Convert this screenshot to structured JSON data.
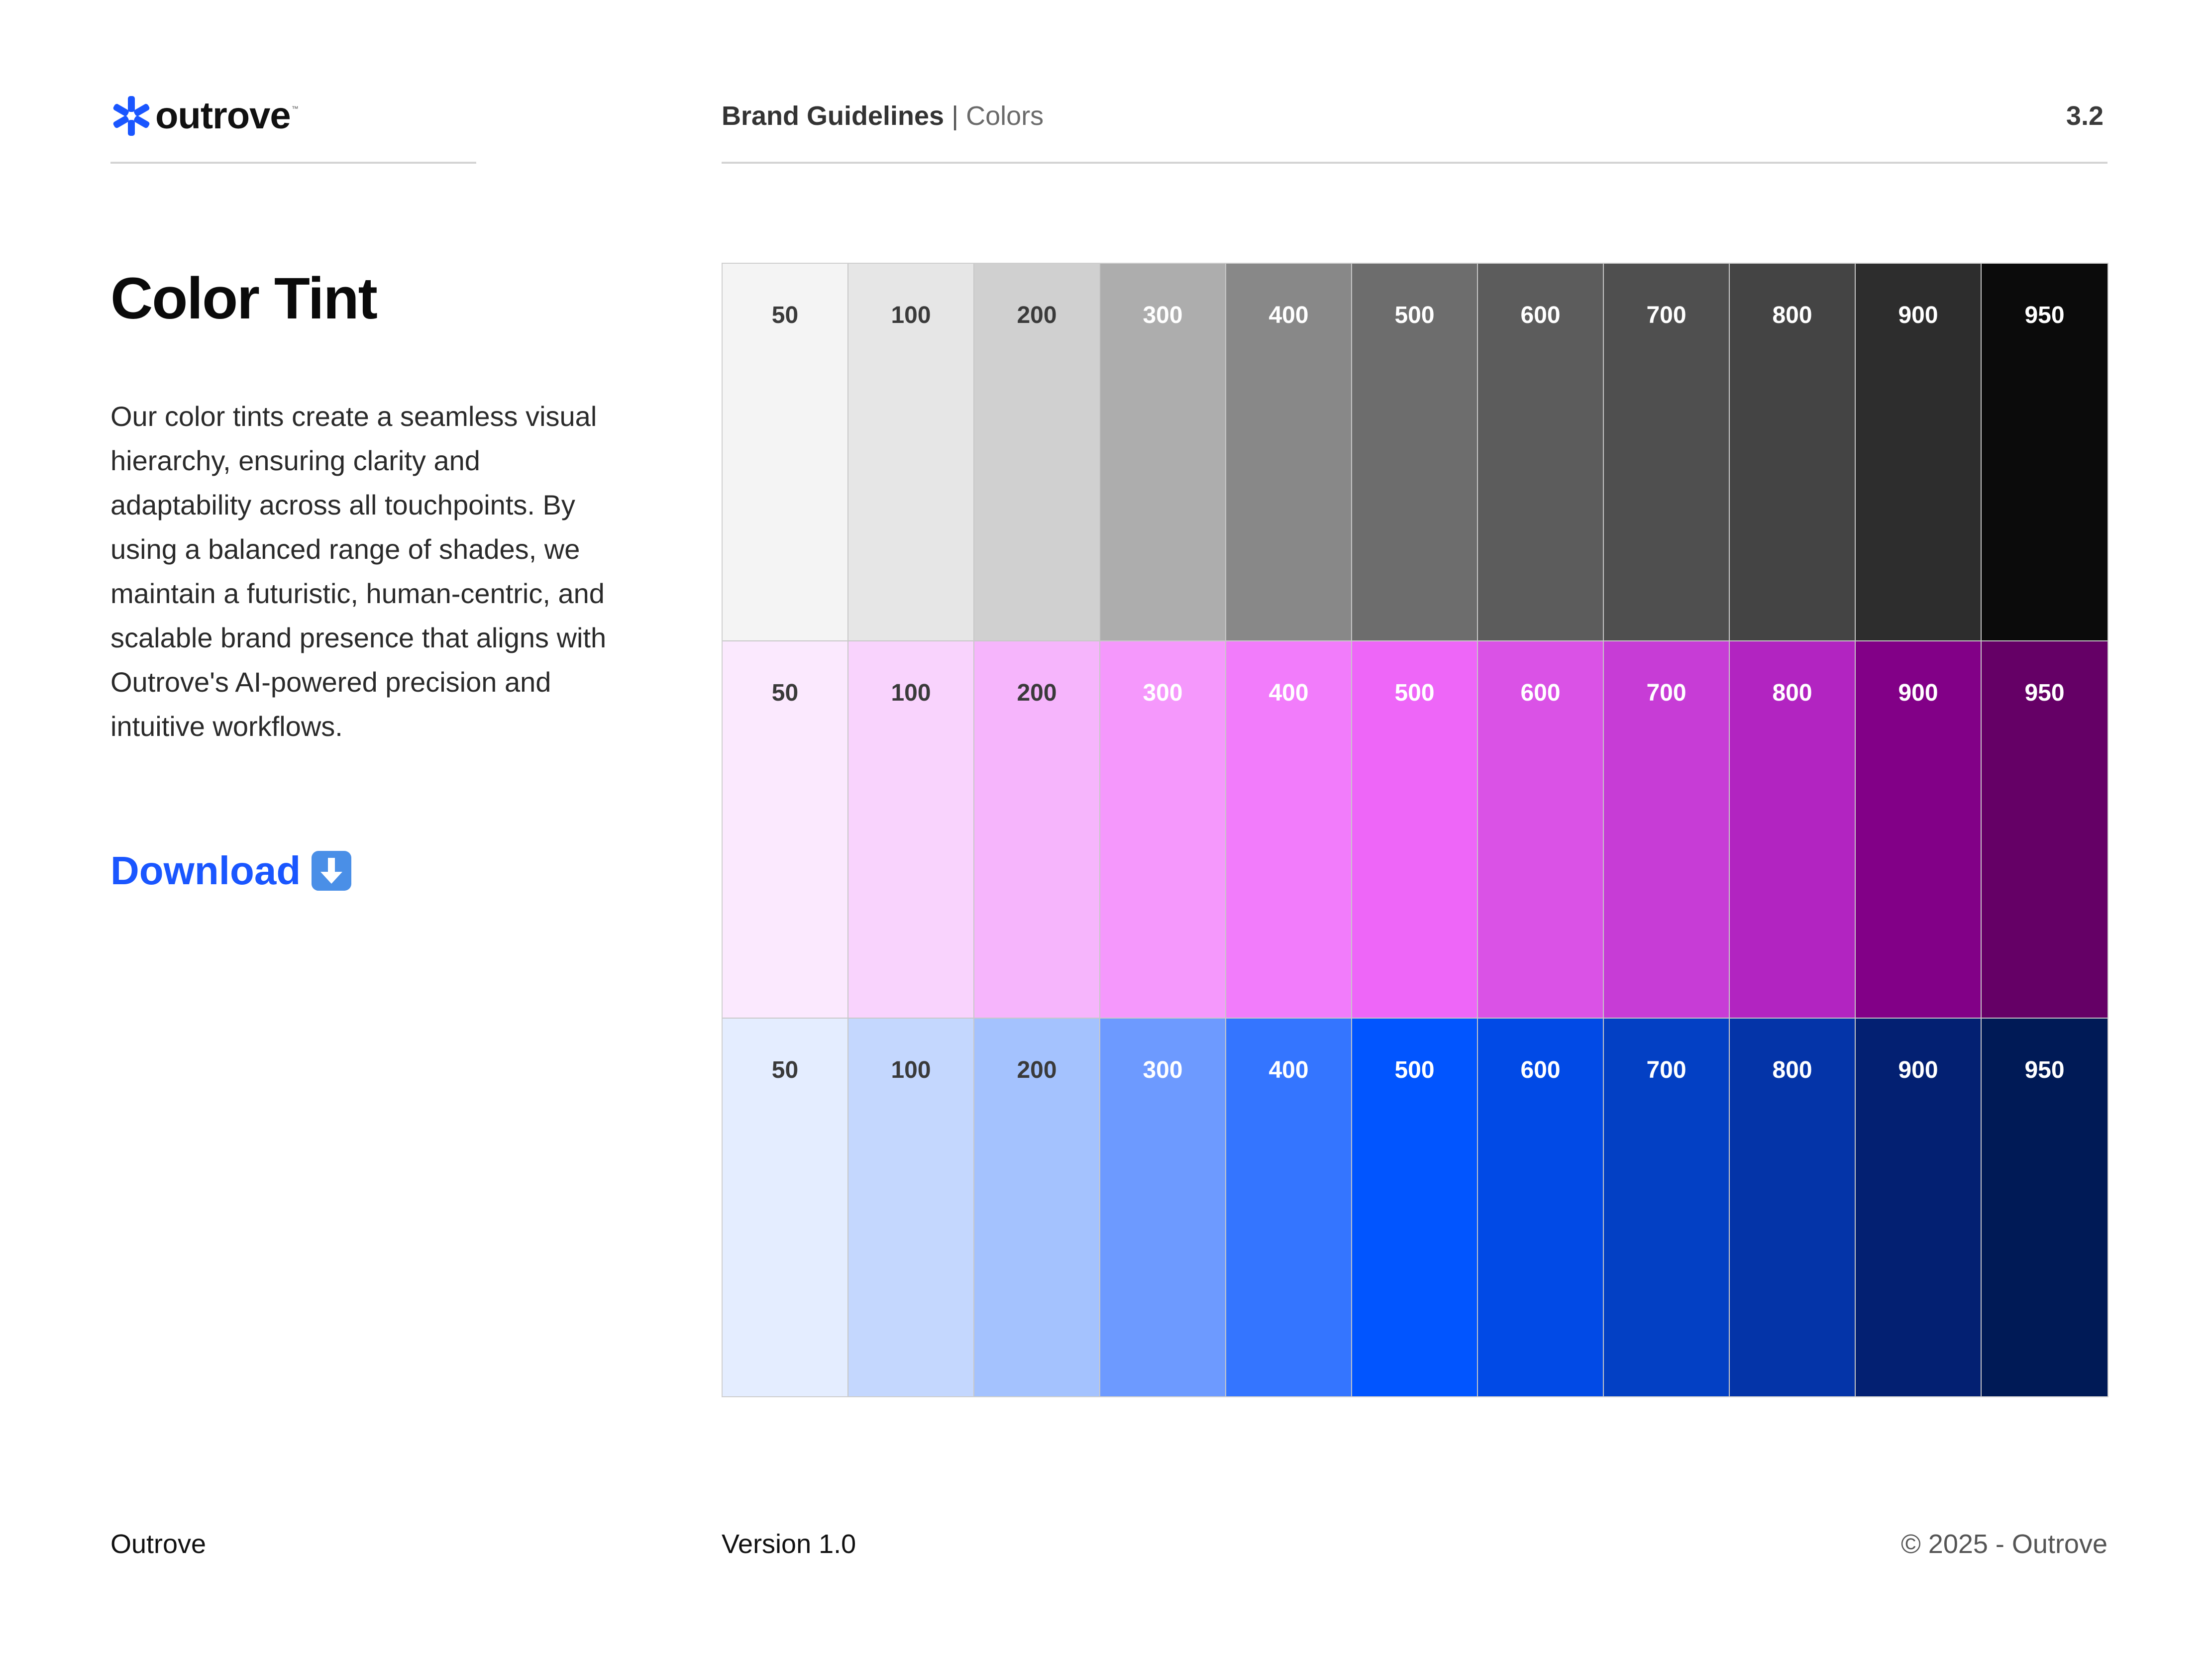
{
  "brand": {
    "logo_text": "outrove",
    "logo_tm": "™",
    "logo_color": "#1a56ff"
  },
  "header": {
    "title": "Brand Guidelines",
    "separator": " | ",
    "section": "Colors",
    "page_number": "3.2"
  },
  "main": {
    "title": "Color Tint",
    "description": "Our color tints create a seamless visual hierarchy, ensuring clarity and adaptability across all touchpoints. By using a balanced range of shades, we maintain a futuristic, human-centric, and scalable brand presence that aligns with Outrove's AI-powered precision and intuitive workflows.",
    "download_label": "Download",
    "download_icon": "down-arrow-emoji-icon"
  },
  "palettes": [
    {
      "name": "neutral",
      "swatches": [
        {
          "label": "50",
          "bg": "#f4f4f4",
          "fg": "#3a3a3a"
        },
        {
          "label": "100",
          "bg": "#e6e6e6",
          "fg": "#3a3a3a"
        },
        {
          "label": "200",
          "bg": "#d0d0d0",
          "fg": "#3a3a3a"
        },
        {
          "label": "300",
          "bg": "#adadad",
          "fg": "#ffffff"
        },
        {
          "label": "400",
          "bg": "#888888",
          "fg": "#ffffff"
        },
        {
          "label": "500",
          "bg": "#6d6d6d",
          "fg": "#ffffff"
        },
        {
          "label": "600",
          "bg": "#5c5c5c",
          "fg": "#ffffff"
        },
        {
          "label": "700",
          "bg": "#4f4f4f",
          "fg": "#ffffff"
        },
        {
          "label": "800",
          "bg": "#444444",
          "fg": "#ffffff"
        },
        {
          "label": "900",
          "bg": "#2d2d2d",
          "fg": "#ffffff"
        },
        {
          "label": "950",
          "bg": "#0b0b0b",
          "fg": "#ffffff"
        }
      ]
    },
    {
      "name": "magenta",
      "swatches": [
        {
          "label": "50",
          "bg": "#fbe9fe",
          "fg": "#3a3a3a"
        },
        {
          "label": "100",
          "bg": "#f9d3fd",
          "fg": "#3a3a3a"
        },
        {
          "label": "200",
          "bg": "#f6b5fc",
          "fg": "#3a3a3a"
        },
        {
          "label": "300",
          "bg": "#f598fc",
          "fg": "#ffffff"
        },
        {
          "label": "400",
          "bg": "#f27cfb",
          "fg": "#ffffff"
        },
        {
          "label": "500",
          "bg": "#ee66f8",
          "fg": "#ffffff"
        },
        {
          "label": "600",
          "bg": "#da52e6",
          "fg": "#ffffff"
        },
        {
          "label": "700",
          "bg": "#c73cd6",
          "fg": "#ffffff"
        },
        {
          "label": "800",
          "bg": "#b224c1",
          "fg": "#ffffff"
        },
        {
          "label": "900",
          "bg": "#820087",
          "fg": "#ffffff"
        },
        {
          "label": "950",
          "bg": "#650066",
          "fg": "#ffffff"
        }
      ]
    },
    {
      "name": "blue",
      "swatches": [
        {
          "label": "50",
          "bg": "#e4edff",
          "fg": "#3a3a3a"
        },
        {
          "label": "100",
          "bg": "#c4d7fe",
          "fg": "#3a3a3a"
        },
        {
          "label": "200",
          "bg": "#a4c2fe",
          "fg": "#3a3a3a"
        },
        {
          "label": "300",
          "bg": "#6d9aff",
          "fg": "#ffffff"
        },
        {
          "label": "400",
          "bg": "#3475ff",
          "fg": "#ffffff"
        },
        {
          "label": "500",
          "bg": "#0155ff",
          "fg": "#ffffff"
        },
        {
          "label": "600",
          "bg": "#014ae6",
          "fg": "#ffffff"
        },
        {
          "label": "700",
          "bg": "#0340c4",
          "fg": "#ffffff"
        },
        {
          "label": "800",
          "bg": "#0434a8",
          "fg": "#ffffff"
        },
        {
          "label": "900",
          "bg": "#032072",
          "fg": "#ffffff"
        },
        {
          "label": "950",
          "bg": "#001a56",
          "fg": "#ffffff"
        }
      ]
    }
  ],
  "footer": {
    "left": "Outrove",
    "middle": "Version 1.0",
    "right": "© 2025 - Outrove"
  }
}
